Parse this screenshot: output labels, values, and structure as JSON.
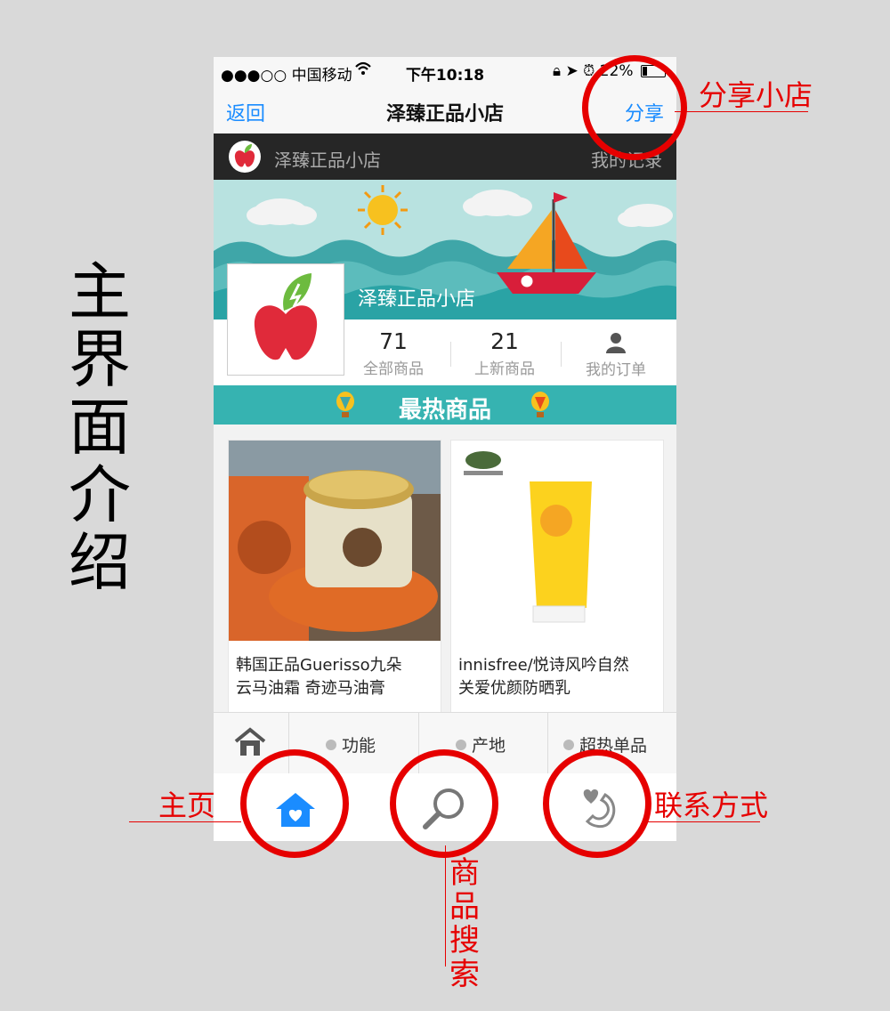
{
  "side_title": [
    "主",
    "界",
    "面",
    "介",
    "绍"
  ],
  "status_bar": {
    "carrier": "●●●○○ 中国移动",
    "time": "下午10:18",
    "battery": "22%"
  },
  "nav": {
    "back": "返回",
    "title": "泽臻正品小店",
    "share": "分享"
  },
  "shop_bar": {
    "name": "泽臻正品小店",
    "records": "我的记录"
  },
  "banner": {
    "shop_name": "泽臻正品小店"
  },
  "stats": [
    {
      "value": "71",
      "label": "全部商品"
    },
    {
      "value": "21",
      "label": "上新商品"
    },
    {
      "value": "",
      "label": "我的订单"
    }
  ],
  "hot_title": "最热商品",
  "products": [
    {
      "line1": "韩国正品Guerisso九朵",
      "line2": "云马油霜 奇迹马油膏"
    },
    {
      "line1": "innisfree/悦诗风吟自然",
      "line2": "关爱优颜防晒乳"
    }
  ],
  "tabs": [
    "功能",
    "产地",
    "超热单品"
  ],
  "annotations": {
    "share_shop": "分享小店",
    "home": "主页",
    "contact": "联系方式",
    "product_search": [
      "商",
      "品",
      "搜",
      "索"
    ]
  },
  "colors": {
    "accent_blue": "#1a8cff",
    "annotation_red": "#e60000",
    "hot_teal": "#36b3b1"
  }
}
